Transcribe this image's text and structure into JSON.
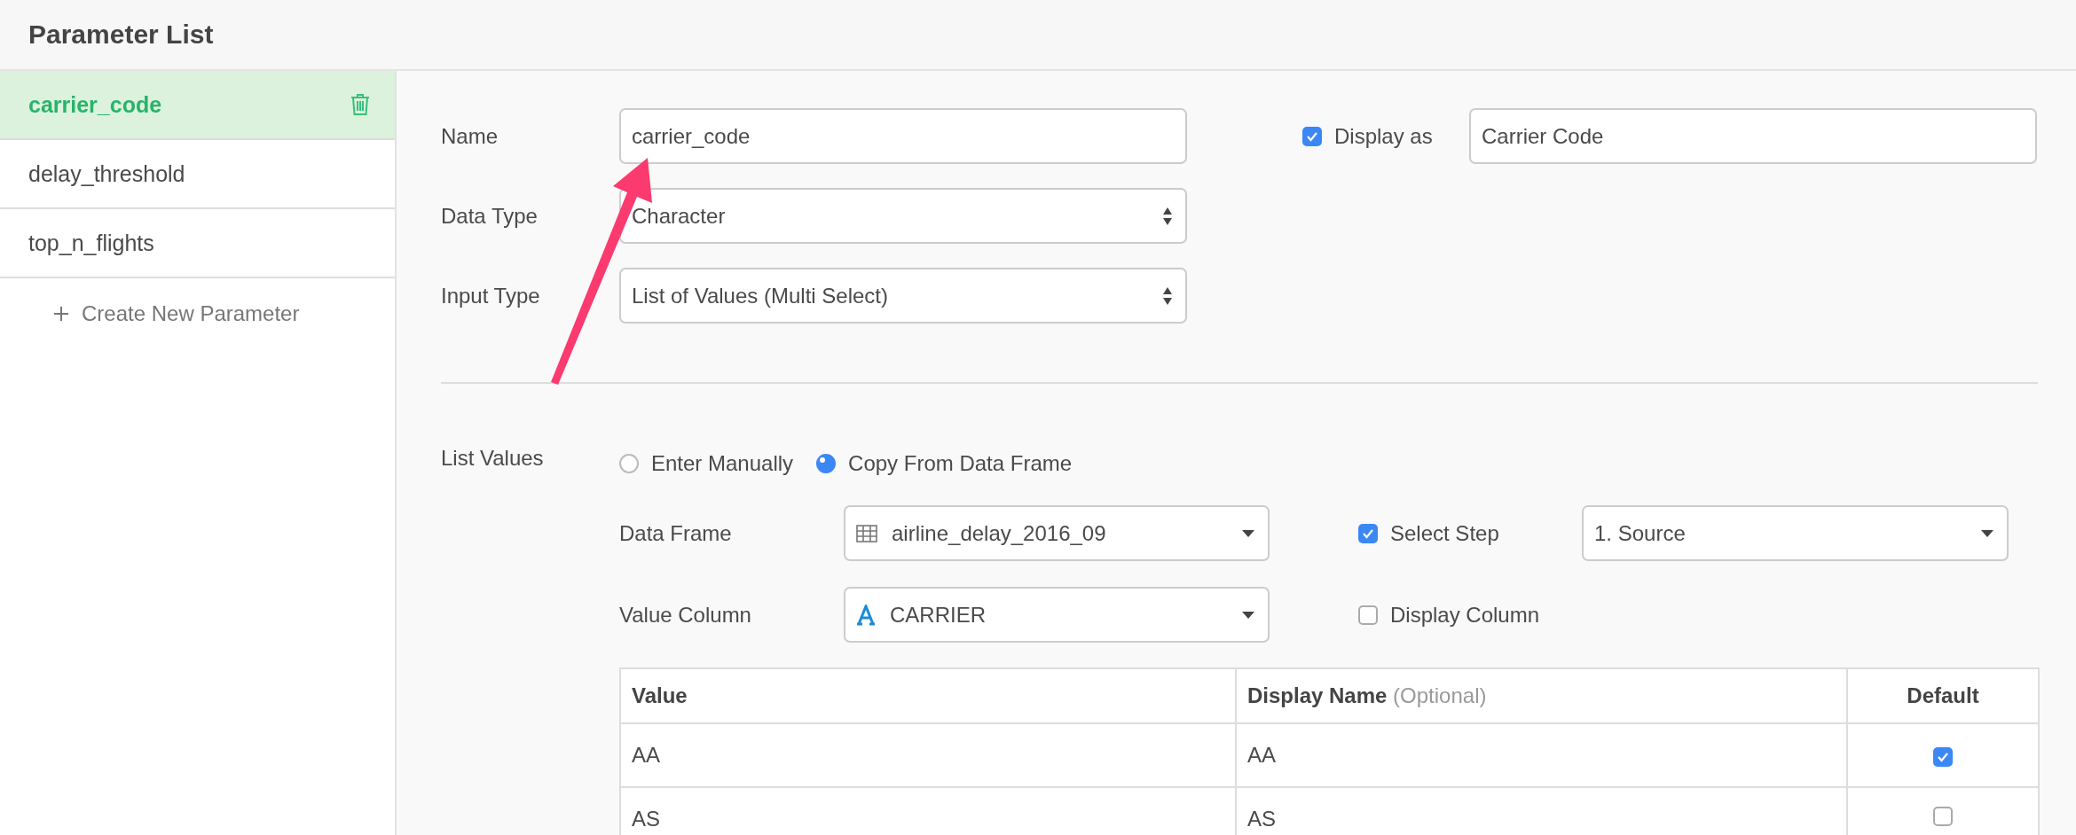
{
  "header": {
    "title": "Parameter List"
  },
  "sidebar": {
    "items": [
      {
        "label": "carrier_code",
        "selected": true
      },
      {
        "label": "delay_threshold",
        "selected": false
      },
      {
        "label": "top_n_flights",
        "selected": false
      }
    ],
    "create_label": "Create New Parameter"
  },
  "form": {
    "fields": [
      {
        "label": "Name",
        "kind": "text",
        "value": "carrier_code"
      },
      {
        "label": "Data Type",
        "kind": "select",
        "value": "Character"
      },
      {
        "label": "Input Type",
        "kind": "select",
        "value": "List of Values (Multi Select)"
      }
    ],
    "display_as": {
      "label": "Display as",
      "checked": true,
      "value": "Carrier Code"
    }
  },
  "list_values": {
    "label": "List Values",
    "options": [
      {
        "label": "Enter Manually",
        "selected": false
      },
      {
        "label": "Copy From Data Frame",
        "selected": true
      }
    ],
    "data_frame": {
      "label": "Data Frame",
      "value": "airline_delay_2016_09"
    },
    "select_step": {
      "label": "Select Step",
      "checked": true,
      "value": "1. Source"
    },
    "value_column": {
      "label": "Value Column",
      "value": "CARRIER"
    },
    "display_column": {
      "label": "Display Column",
      "checked": false
    },
    "table": {
      "columns": [
        {
          "label": "Value"
        },
        {
          "label": "Display Name",
          "hint": "(Optional)"
        },
        {
          "label": "Default"
        }
      ],
      "rows": [
        {
          "value": "AA",
          "display_name": "AA",
          "default": true
        },
        {
          "value": "AS",
          "display_name": "AS",
          "default": false
        }
      ]
    }
  }
}
